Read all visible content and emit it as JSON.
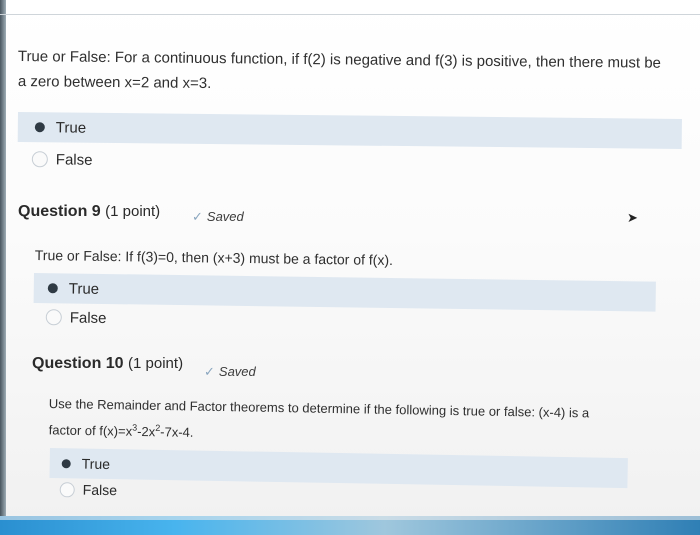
{
  "question8": {
    "text_line1": "True or False: For a continuous function, if f(2) is negative and f(3) is positive, then there must be",
    "text_line2": "a zero between x=2 and x=3.",
    "options": [
      {
        "label": "True",
        "selected": true
      },
      {
        "label": "False",
        "selected": false
      }
    ]
  },
  "question9": {
    "title": "Question 9",
    "points": "(1 point)",
    "status": "Saved",
    "text": "True or False: If f(3)=0, then (x+3) must be a factor of f(x).",
    "options": [
      {
        "label": "True",
        "selected": true
      },
      {
        "label": "False",
        "selected": false
      }
    ]
  },
  "question10": {
    "title": "Question 10",
    "points": "(1 point)",
    "status": "Saved",
    "text_line1": "Use the Remainder and Factor theorems to determine if the following is true or false: (x-4) is a",
    "text_line2_prefix": "factor of f(x)=x",
    "exp1": "3",
    "mid": "-2x",
    "exp2": "2",
    "suffix": "-7x-4.",
    "options": [
      {
        "label": "True",
        "selected": true
      },
      {
        "label": "False",
        "selected": false
      }
    ]
  },
  "colors": {
    "selected_row": "#dfe8f1",
    "check": "#8aa6bf"
  },
  "icons": {
    "saved": "check-icon",
    "cursor": "mouse-pointer-icon"
  }
}
